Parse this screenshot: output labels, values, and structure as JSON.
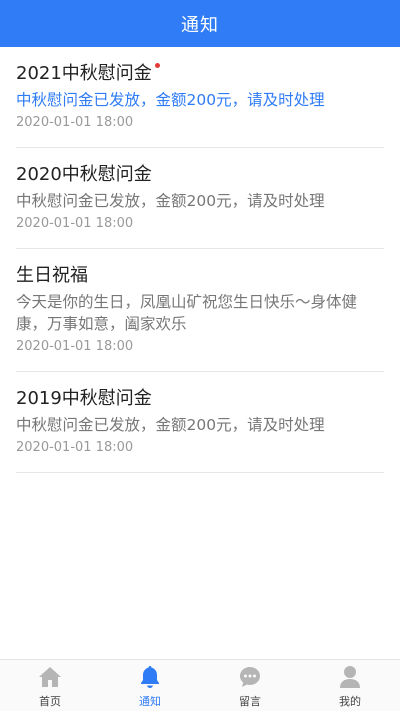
{
  "header": {
    "title": "通知"
  },
  "notices": [
    {
      "title": "2021中秋慰问金",
      "body": "中秋慰问金已发放，金额200元，请及时处理",
      "time": "2020-01-01 18:00",
      "unread": true
    },
    {
      "title": "2020中秋慰问金",
      "body": "中秋慰问金已发放，金额200元，请及时处理",
      "time": "2020-01-01 18:00",
      "unread": false
    },
    {
      "title": "生日祝福",
      "body": "今天是你的生日，凤凰山矿祝您生日快乐～身体健康，万事如意，阖家欢乐",
      "time": "2020-01-01 18:00",
      "unread": false
    },
    {
      "title": "2019中秋慰问金",
      "body": "中秋慰问金已发放，金额200元，请及时处理",
      "time": "2020-01-01 18:00",
      "unread": false
    }
  ],
  "tabbar": {
    "items": [
      {
        "label": "首页",
        "icon": "home-icon",
        "active": false
      },
      {
        "label": "通知",
        "icon": "bell-icon",
        "active": true
      },
      {
        "label": "留言",
        "icon": "message-icon",
        "active": false
      },
      {
        "label": "我的",
        "icon": "user-icon",
        "active": false
      }
    ]
  },
  "colors": {
    "primary": "#2f7cf6",
    "unread_dot": "#e53935",
    "inactive_icon": "#b5b5b5"
  }
}
